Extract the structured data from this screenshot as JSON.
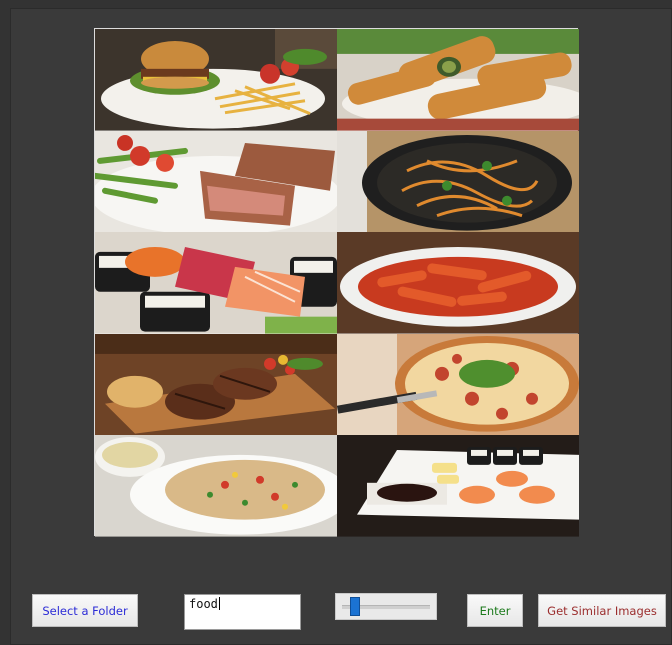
{
  "controls": {
    "select_folder_label": "Select a Folder",
    "search_value": "food",
    "enter_label": "Enter",
    "similar_label": "Get Similar Images",
    "slider_value": 0.1
  },
  "gallery": {
    "images": [
      {
        "name": "burger-fries-photo"
      },
      {
        "name": "spring-rolls-photo"
      },
      {
        "name": "steak-salad-photo"
      },
      {
        "name": "stir-fry-noodles-photo"
      },
      {
        "name": "sushi-platter-photo"
      },
      {
        "name": "tteokbokki-photo"
      },
      {
        "name": "grilled-steak-board-photo"
      },
      {
        "name": "pizza-photo"
      },
      {
        "name": "fried-rice-photo"
      },
      {
        "name": "sushi-plate-photo"
      }
    ]
  },
  "colors": {
    "background": "#333333",
    "folder_text": "#2b2bd6",
    "enter_text": "#1c7a1c",
    "similar_text": "#9b2d2d",
    "slider_thumb": "#1b73d3"
  }
}
